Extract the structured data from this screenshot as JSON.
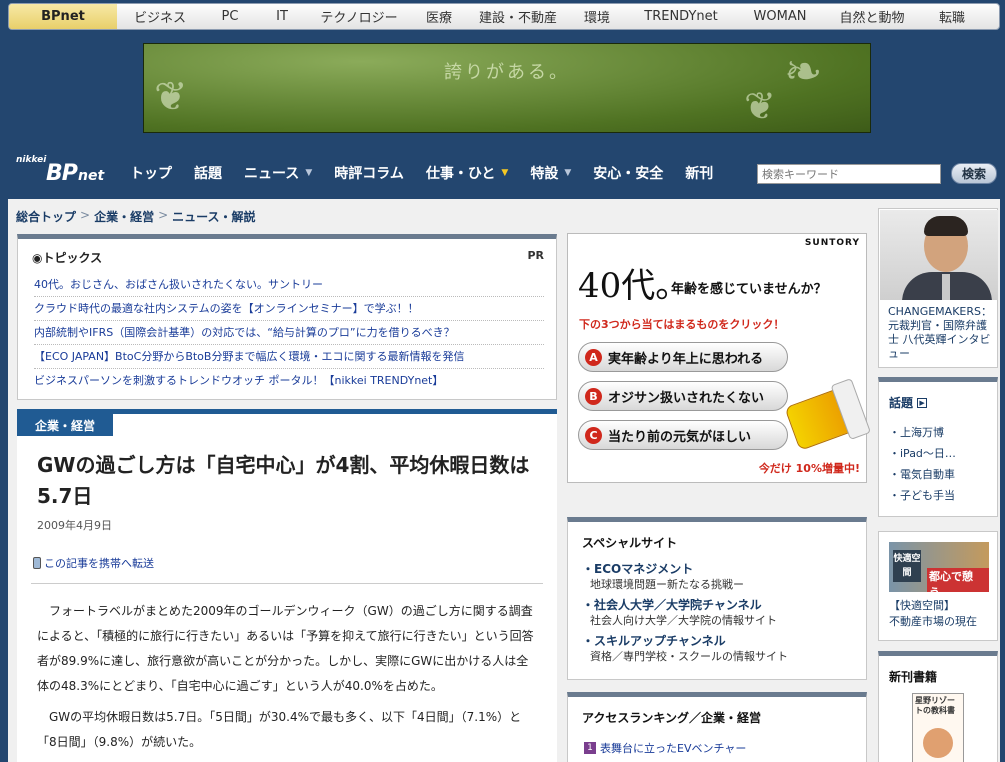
{
  "site_tabs": [
    {
      "label": "BPnet",
      "active": true
    },
    {
      "label": "ビジネス"
    },
    {
      "label": "PC"
    },
    {
      "label": "IT"
    },
    {
      "label": "テクノロジー"
    },
    {
      "label": "医療"
    },
    {
      "label": "建設・不動産"
    },
    {
      "label": "環境"
    },
    {
      "label": "TRENDYnet"
    },
    {
      "label": "WOMAN"
    },
    {
      "label": "自然と動物"
    },
    {
      "label": "転職"
    }
  ],
  "banner": {
    "text": "誇りがある。"
  },
  "logo": {
    "small": "nikkei",
    "main": "BP",
    "suffix": "net"
  },
  "nav": [
    {
      "label": "トップ"
    },
    {
      "label": "話題"
    },
    {
      "label": "ニュース",
      "caret": "down"
    },
    {
      "label": "時評コラム"
    },
    {
      "label": "仕事・ひと",
      "caret": "down-yellow"
    },
    {
      "label": "特設",
      "caret": "down"
    },
    {
      "label": "安心・安全"
    },
    {
      "label": "新刊"
    }
  ],
  "search": {
    "placeholder": "検索キーワード",
    "button": "検索"
  },
  "breadcrumb": [
    "総合トップ",
    "企業・経営",
    "ニュース・解説"
  ],
  "topics": {
    "title": "◉トピックス",
    "pr": "PR",
    "items": [
      "40代。おじさん、おばさん扱いされたくない。サントリー",
      "クラウド時代の最適な社内システムの姿を【オンラインセミナー】で学ぶ！！",
      "内部統制やIFRS（国際会計基準）の対応では、“給与計算のプロ”に力を借りるべき？",
      "【ECO JAPAN】BtoC分野からBtoB分野まで幅広く環境・エコに関する最新情報を発信",
      "ビジネスパーソンを刺激するトレンドウオッチ ポータル！【nikkei TRENDYnet】"
    ]
  },
  "article": {
    "category": "企業・経営",
    "title": "GWの過ごし方は「自宅中心」が4割、平均休暇日数は5.7日",
    "date": "2009年4月9日",
    "mobile_link": "この記事を携帯へ転送",
    "paragraphs": [
      "フォートラベルがまとめた2009年のゴールデンウィーク（GW）の過ごし方に関する調査によると、「積極的に旅行に行きたい」あるいは「予算を抑えて旅行に行きたい」という回答者が89.9%に達し、旅行意欲が高いことが分かった。しかし、実際にGWに出かける人は全体の48.3%にとどまり、「自宅中心に過ごす」という人が40.0%を占めた。",
      "GWの平均休暇日数は5.7日。「5日間」が30.4%で最も多く、以下「4日間」（7.1%）と「8日間」（9.8%）が続いた。"
    ]
  },
  "ad": {
    "brand": "SUNTORY",
    "headline": "40代。",
    "question": "年齢を感じていませんか？",
    "instruction": "下の3つから当てはまるものをクリック！",
    "options": [
      {
        "badge": "A",
        "label": "実年齢より年上に思われる"
      },
      {
        "badge": "B",
        "label": "オジサン扱いされたくない"
      },
      {
        "badge": "C",
        "label": "当たり前の元気がほしい"
      }
    ],
    "promo": "今だけ 10%増量中!"
  },
  "special_sites": {
    "title": "スペシャルサイト",
    "items": [
      {
        "title": "ECOマネジメント",
        "desc": "地球環境問題ー新たなる挑戦ー"
      },
      {
        "title": "社会人大学／大学院チャンネル",
        "desc": "社会人向け大学／大学院の情報サイト"
      },
      {
        "title": "スキルアップチャンネル",
        "desc": "資格／専門学校・スクールの情報サイト"
      }
    ]
  },
  "ranking": {
    "title": "アクセスランキング／企業・経営",
    "items": [
      {
        "rank": "1",
        "label": "表舞台に立ったEVベンチャー"
      }
    ]
  },
  "changemakers": {
    "caption": "CHANGEMAKERS：元裁判官・国際弁護士 八代英輝インタビュー"
  },
  "wadai": {
    "title": "話題",
    "items": [
      "上海万博",
      "iPad〜日…",
      "電気自動車",
      "子ども手当"
    ]
  },
  "kaiteki": {
    "img_text_1": "快適空間",
    "img_text_2": "都心で憩う。",
    "caption_1": "【快適空間】",
    "caption_2": "不動産市場の現在"
  },
  "books": {
    "title": "新刊書籍",
    "cover_text": "星野リゾートの教科書"
  },
  "colors": {
    "navy": "#23466f",
    "accent_blue": "#205b93",
    "link": "#1a3c99",
    "ad_red": "#d0281c"
  }
}
